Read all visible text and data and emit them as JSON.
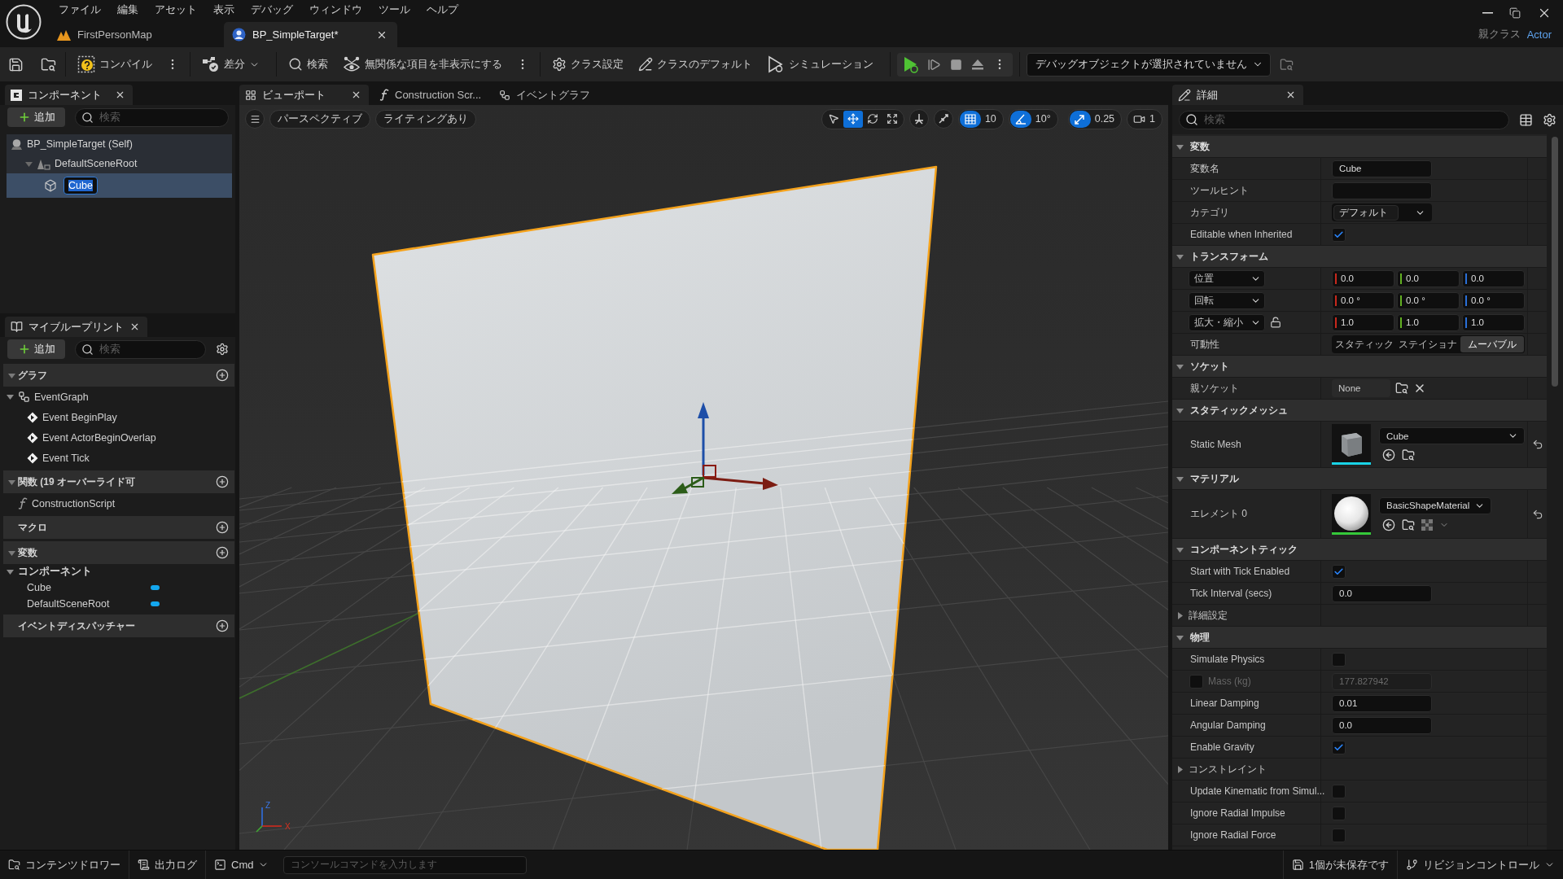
{
  "menu_bar": [
    "ファイル",
    "編集",
    "アセット",
    "表示",
    "デバッグ",
    "ウィンドウ",
    "ツール",
    "ヘルプ"
  ],
  "document_tabs": [
    {
      "label": "FirstPersonMap",
      "kind": "level",
      "selected": false
    },
    {
      "label": "BP_SimpleTarget*",
      "kind": "blueprint",
      "selected": true
    }
  ],
  "parent_class": {
    "label": "親クラス",
    "value": "Actor"
  },
  "toolbar": {
    "compile": "コンパイル",
    "diff": "差分",
    "find": "検索",
    "hide_unrelated": "無関係な項目を非表示にする",
    "class_settings": "クラス設定",
    "class_defaults": "クラスのデフォルト",
    "simulation": "シミュレーション",
    "debug_object": "デバッグオブジェクトが選択されていません"
  },
  "components_panel": {
    "title": "コンポーネント",
    "add_button": "追加",
    "search_placeholder": "検索",
    "tree": [
      {
        "label": "BP_SimpleTarget (Self)",
        "kind": "actor",
        "selected": false,
        "children": [
          {
            "label": "DefaultSceneRoot",
            "kind": "scene",
            "selected": false,
            "expanded": true,
            "children": [
              {
                "label": "Cube",
                "kind": "mesh",
                "selected": true,
                "editing": true
              }
            ]
          }
        ]
      }
    ]
  },
  "my_blueprint_panel": {
    "title": "マイブループリント",
    "add_button": "追加",
    "search_placeholder": "検索",
    "sections": [
      {
        "title": "グラフ",
        "expanded": true,
        "items": [
          {
            "label": "EventGraph",
            "kind": "graph",
            "expanded": true,
            "children": [
              {
                "label": "Event BeginPlay",
                "kind": "event"
              },
              {
                "label": "Event ActorBeginOverlap",
                "kind": "event"
              },
              {
                "label": "Event Tick",
                "kind": "event"
              }
            ]
          }
        ]
      },
      {
        "title": "関数 (19 オーバーライド可",
        "expanded": true,
        "items": [
          {
            "label": "ConstructionScript",
            "kind": "function"
          }
        ]
      },
      {
        "title": "マクロ"
      },
      {
        "title": "変数",
        "expanded": true,
        "items": [
          {
            "label": "コンポーネント",
            "kind": "category",
            "expanded": true,
            "children": [
              {
                "label": "Cube",
                "kind": "variable"
              },
              {
                "label": "DefaultSceneRoot",
                "kind": "variable"
              }
            ]
          }
        ]
      },
      {
        "title": "イベントディスパッチャー"
      }
    ]
  },
  "viewport_tabs": [
    {
      "label": "ビューポート",
      "kind": "viewport",
      "selected": true
    },
    {
      "label": "Construction Scr...",
      "kind": "function",
      "selected": false
    },
    {
      "label": "イベントグラフ",
      "kind": "graph",
      "selected": false
    }
  ],
  "viewport": {
    "view_mode": "パースペクティブ",
    "lighting": "ライティングあり",
    "transform_tools": [
      {
        "kind": "select",
        "selected": false
      },
      {
        "kind": "translate",
        "selected": true
      },
      {
        "kind": "rotate",
        "selected": false
      },
      {
        "kind": "scale",
        "selected": false
      }
    ],
    "grid_snap": {
      "value": "10",
      "on": true
    },
    "rotation_snap": {
      "value": "10°",
      "on": true
    },
    "scale_snap": {
      "value": "0.25",
      "on": true
    },
    "camera_speed": "1",
    "axis_labels": {
      "up": "Z",
      "right": "X"
    }
  },
  "details_panel": {
    "title": "詳細",
    "search_placeholder": "検索",
    "sections": [
      {
        "title": "変数",
        "expanded": true,
        "rows": [
          {
            "label": "変数名",
            "kind": "text",
            "value": "Cube"
          },
          {
            "label": "ツールヒント",
            "kind": "text"
          },
          {
            "label": "カテゴリ",
            "kind": "combo",
            "value": "デフォルト"
          },
          {
            "label": "Editable when Inherited",
            "kind": "checkbox",
            "checked": true
          }
        ]
      },
      {
        "title": "トランスフォーム",
        "expanded": true,
        "rows": [
          {
            "label": "位置",
            "kind": "vector",
            "values": [
              "0.0",
              "0.0",
              "0.0"
            ]
          },
          {
            "label": "回転",
            "kind": "vector",
            "values": [
              "0.0 °",
              "0.0 °",
              "0.0 °"
            ]
          },
          {
            "label": "拡大・縮小",
            "kind": "vector",
            "locked": false,
            "values": [
              "1.0",
              "1.0",
              "1.0"
            ]
          },
          {
            "label": "可動性",
            "kind": "segmented",
            "options": [
              {
                "label": "スタティック",
                "selected": false
              },
              {
                "label": "ステイショナ",
                "selected": false
              },
              {
                "label": "ムーバブル",
                "selected": true
              }
            ]
          }
        ]
      },
      {
        "title": "ソケット",
        "expanded": true,
        "rows": [
          {
            "label": "親ソケット",
            "kind": "socket",
            "value": "None"
          }
        ]
      },
      {
        "title": "スタティックメッシュ",
        "expanded": true,
        "rows": [
          {
            "label": "Static Mesh",
            "kind": "mesh_asset",
            "value": "Cube"
          }
        ]
      },
      {
        "title": "マテリアル",
        "expanded": true,
        "rows": [
          {
            "label": "エレメント 0",
            "kind": "material_asset",
            "value": "BasicShapeMaterial"
          }
        ]
      },
      {
        "title": "コンポーネントティック",
        "expanded": true,
        "rows": [
          {
            "label": "Start with Tick Enabled",
            "kind": "checkbox",
            "checked": true
          },
          {
            "label": "Tick Interval (secs)",
            "kind": "number",
            "value": "0.0"
          },
          {
            "label": "詳細設定",
            "kind": "group",
            "expanded": false
          }
        ]
      },
      {
        "title": "物理",
        "expanded": true,
        "rows": [
          {
            "label": "Simulate Physics",
            "kind": "checkbox",
            "checked": false
          },
          {
            "label": "Mass (kg)",
            "kind": "override_number",
            "checked": false,
            "disabled": true,
            "value": "177.827942"
          },
          {
            "label": "Linear Damping",
            "kind": "number",
            "value": "0.01"
          },
          {
            "label": "Angular Damping",
            "kind": "number",
            "value": "0.0"
          },
          {
            "label": "Enable Gravity",
            "kind": "checkbox",
            "checked": true
          },
          {
            "label": "コンストレイント",
            "kind": "group",
            "expanded": false
          },
          {
            "label": "Update Kinematic from Simul...",
            "kind": "checkbox",
            "checked": false
          },
          {
            "label": "Ignore Radial Impulse",
            "kind": "checkbox",
            "checked": false
          },
          {
            "label": "Ignore Radial Force",
            "kind": "checkbox",
            "checked": false
          }
        ]
      }
    ]
  },
  "status_bar": {
    "content_drawer": "コンテンツドロワー",
    "output_log": "出力ログ",
    "cmd": "Cmd",
    "console_placeholder": "コンソールコマンドを入力します",
    "unsaved": "1個が未保存です",
    "revision_control": "リビジョンコントロール"
  }
}
